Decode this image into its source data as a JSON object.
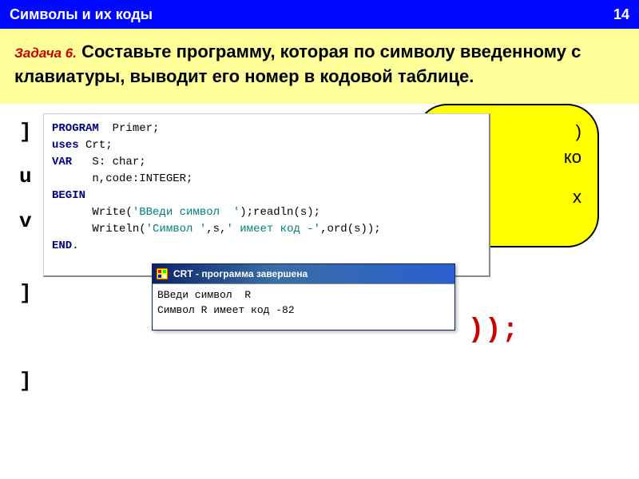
{
  "header": {
    "title": "Символы  и их коды",
    "page": "14"
  },
  "task": {
    "label": "Задача 6.",
    "text": " Составьте программу, которая по символу введенному с клавиатуры, выводит его номер в кодовой таблице."
  },
  "bubble": {
    "l1": ")",
    "l2": "ко",
    "l3": "х"
  },
  "left": {
    "f1": "]",
    "f2": "u",
    "f3": "v",
    "f4": "]",
    "f5": "]"
  },
  "red": "));",
  "code": {
    "l1_kw": "PROGRAM",
    "l1_rest": "  Primer;",
    "l2_kw": "uses",
    "l2_rest": " Crt;",
    "l3_kw": "VAR",
    "l3_rest": "   S: char;",
    "l4": "      n,code:INTEGER;",
    "l5_kw": "BEGIN",
    "l6a": "      Write(",
    "l6s": "'ВВеди символ  '",
    "l6b": ");readln(s);",
    "l7a": "      Writeln(",
    "l7s1": "'Символ '",
    "l7b": ",s,",
    "l7s2": "' имеет код -'",
    "l7c": ",ord(s));",
    "l8_kw": "END",
    "l8_rest": "."
  },
  "crt": {
    "title": "CRT - программа завершена",
    "out1": "ВВеди символ  R",
    "out2": "Символ R имеет код -82"
  }
}
